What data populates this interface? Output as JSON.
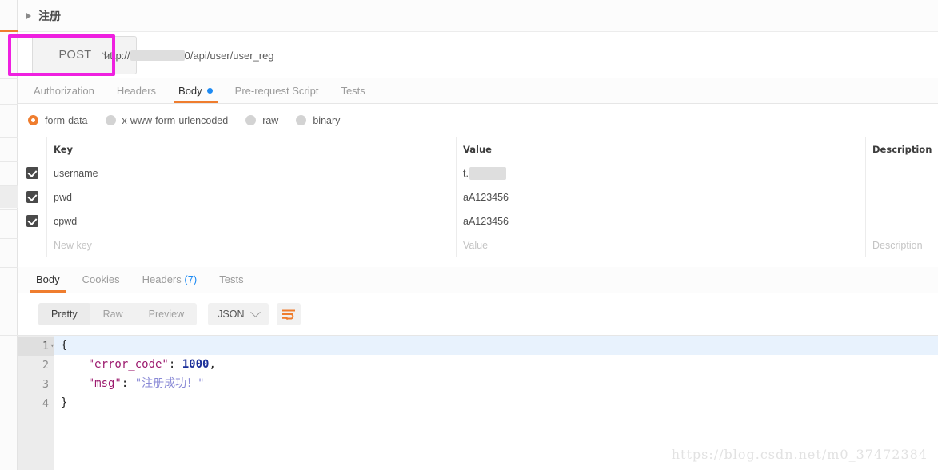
{
  "request": {
    "collapse_icon": "caret-right-icon",
    "title": "注册",
    "method": "POST",
    "method_caret": "chevron-down-icon",
    "url_prefix": "http://",
    "url_redacted_placeholder": "",
    "url_suffix": "0/api/user/user_reg",
    "highlight_color": "#ef20e0",
    "accent_color": "#ef7d2e",
    "tabs": [
      {
        "label": "Authorization",
        "active": false,
        "dot": false
      },
      {
        "label": "Headers",
        "active": false,
        "dot": false
      },
      {
        "label": "Body",
        "active": true,
        "dot": true
      },
      {
        "label": "Pre-request Script",
        "active": false,
        "dot": false
      },
      {
        "label": "Tests",
        "active": false,
        "dot": false
      }
    ],
    "body_types": [
      {
        "label": "form-data",
        "selected": true
      },
      {
        "label": "x-www-form-urlencoded",
        "selected": false
      },
      {
        "label": "raw",
        "selected": false
      },
      {
        "label": "binary",
        "selected": false
      }
    ],
    "table": {
      "headers": {
        "key": "Key",
        "value": "Value",
        "description": "Description"
      },
      "rows": [
        {
          "checked": true,
          "key": "username",
          "value": "t.",
          "value_redacted": true,
          "description": ""
        },
        {
          "checked": true,
          "key": "pwd",
          "value": "aA123456",
          "value_redacted": false,
          "description": ""
        },
        {
          "checked": true,
          "key": "cpwd",
          "value": "aA123456",
          "value_redacted": false,
          "description": ""
        }
      ],
      "new_row": {
        "key_placeholder": "New key",
        "value_placeholder": "Value",
        "description_placeholder": "Description"
      }
    }
  },
  "response": {
    "tabs": [
      {
        "label": "Body",
        "active": true,
        "count": ""
      },
      {
        "label": "Cookies",
        "active": false,
        "count": ""
      },
      {
        "label": "Headers",
        "active": false,
        "count": "(7)"
      },
      {
        "label": "Tests",
        "active": false,
        "count": ""
      }
    ],
    "view_modes": [
      {
        "label": "Pretty",
        "active": true
      },
      {
        "label": "Raw",
        "active": false
      },
      {
        "label": "Preview",
        "active": false
      }
    ],
    "format": {
      "label": "JSON",
      "caret": "chevron-down-icon"
    },
    "wrap_icon": "word-wrap-icon",
    "code_lines": [
      {
        "n": "1",
        "foldable": true,
        "highlight": true,
        "text": "{"
      },
      {
        "n": "2",
        "foldable": false,
        "highlight": false,
        "text": "    \"error_code\": 1000,"
      },
      {
        "n": "3",
        "foldable": false,
        "highlight": false,
        "text": "    \"msg\": \"注册成功！\""
      },
      {
        "n": "4",
        "foldable": false,
        "highlight": false,
        "text": "}"
      }
    ],
    "json": {
      "error_code": 1000,
      "msg": "注册成功！"
    }
  },
  "watermark": "https://blog.csdn.net/m0_37472384"
}
